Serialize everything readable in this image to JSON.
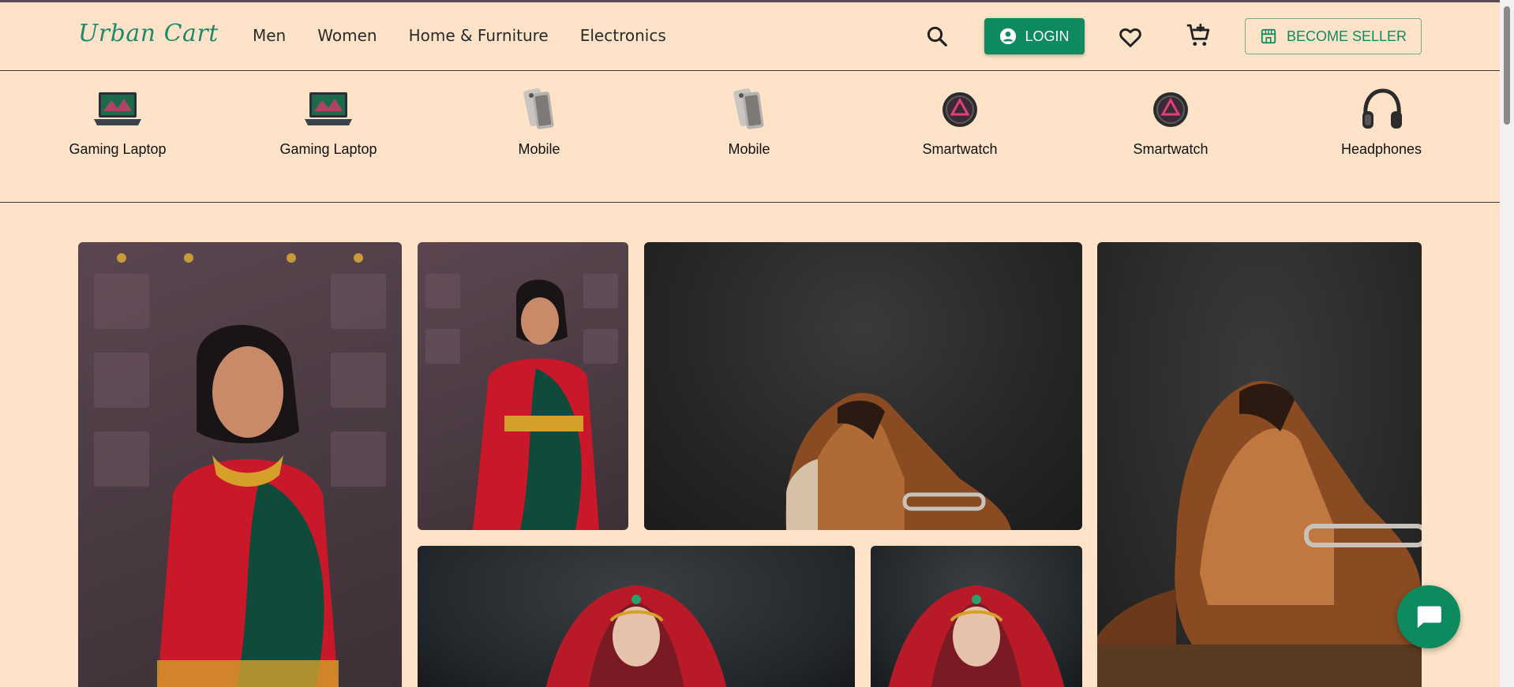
{
  "header": {
    "logo": "Urban Cart",
    "nav": [
      "Men",
      "Women",
      "Home & Furniture",
      "Electronics"
    ],
    "login_label": "LOGIN",
    "seller_label": "BECOME SELLER"
  },
  "categories": [
    {
      "label": "Gaming Laptop",
      "icon": "laptop-icon"
    },
    {
      "label": "Gaming Laptop",
      "icon": "laptop-icon"
    },
    {
      "label": "Mobile",
      "icon": "phone-icon"
    },
    {
      "label": "Mobile",
      "icon": "phone-icon"
    },
    {
      "label": "Smartwatch",
      "icon": "watch-icon"
    },
    {
      "label": "Smartwatch",
      "icon": "watch-icon"
    },
    {
      "label": "Headphones",
      "icon": "headphones-icon"
    }
  ],
  "gallery": [
    {
      "subject": "woman-in-saree"
    },
    {
      "subject": "woman-in-saree"
    },
    {
      "subject": "brown-loafer"
    },
    {
      "subject": "brown-loafer"
    },
    {
      "subject": "bride-red-veil"
    },
    {
      "subject": "bride-red-veil"
    }
  ],
  "colors": {
    "background": "#fee3c8",
    "accent": "#0e8a5f",
    "logo": "#1f8a6a"
  }
}
